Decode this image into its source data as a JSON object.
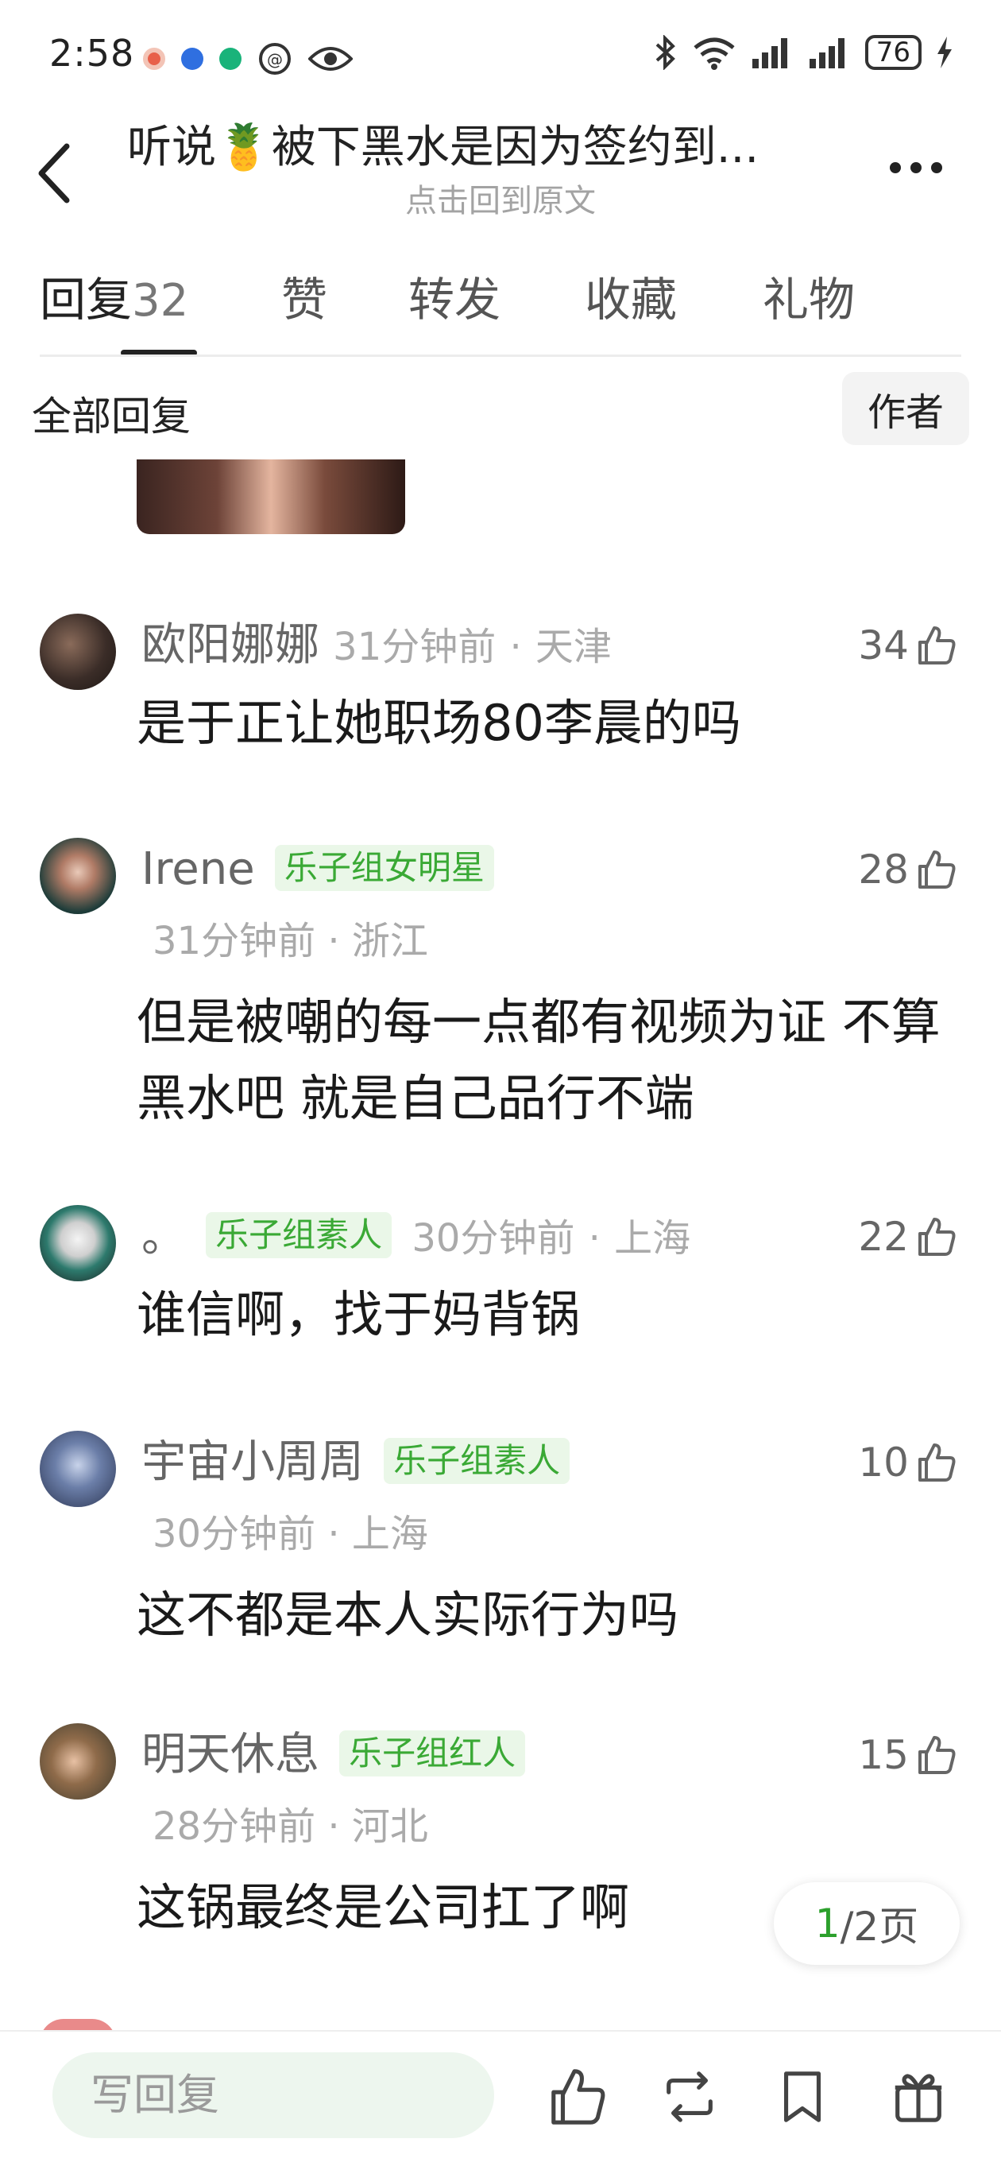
{
  "status_bar": {
    "time": "2:58",
    "battery": "76",
    "app_icons": [
      "app-red",
      "app-blue",
      "app-teal"
    ]
  },
  "header": {
    "title": "听说🍍被下黑水是因为签约到...",
    "subtitle": "点击回到原文"
  },
  "tabs": [
    {
      "label": "回复",
      "count": "32"
    },
    {
      "label": "赞"
    },
    {
      "label": "转发"
    },
    {
      "label": "收藏"
    },
    {
      "label": "礼物"
    }
  ],
  "filter": {
    "all_label": "全部回复",
    "author_label": "作者"
  },
  "comments": [
    {
      "name": "欧阳娜娜",
      "badge": "",
      "time": "31分钟前",
      "location": "天津",
      "likes": "34",
      "text": "是于正让她职场80李晨的吗"
    },
    {
      "name": "Irene",
      "badge": "乐子组女明星",
      "time": "31分钟前",
      "location": "浙江",
      "likes": "28",
      "text": "但是被嘲的每一点都有视频为证 不算黑水吧 就是自己品行不端"
    },
    {
      "name": "。",
      "badge": "乐子组素人",
      "time": "30分钟前",
      "location": "上海",
      "likes": "22",
      "text": "谁信啊，找于妈背锅"
    },
    {
      "name": "宇宙小周周",
      "badge": "乐子组素人",
      "time": "30分钟前",
      "location": "上海",
      "likes": "10",
      "text": "这不都是本人实际行为吗"
    },
    {
      "name": "明天休息",
      "badge": "乐子组红人",
      "time": "28分钟前",
      "location": "河北",
      "likes": "15",
      "text": "这锅最终是公司扛了啊"
    }
  ],
  "pagination": {
    "current": "1",
    "rest": "/2页"
  },
  "bottom_bar": {
    "reply_placeholder": "写回复"
  },
  "colors": {
    "badge_green": "#3aa935",
    "badge_bg": "#eaf7e8",
    "reply_bg": "#edf6ee"
  }
}
